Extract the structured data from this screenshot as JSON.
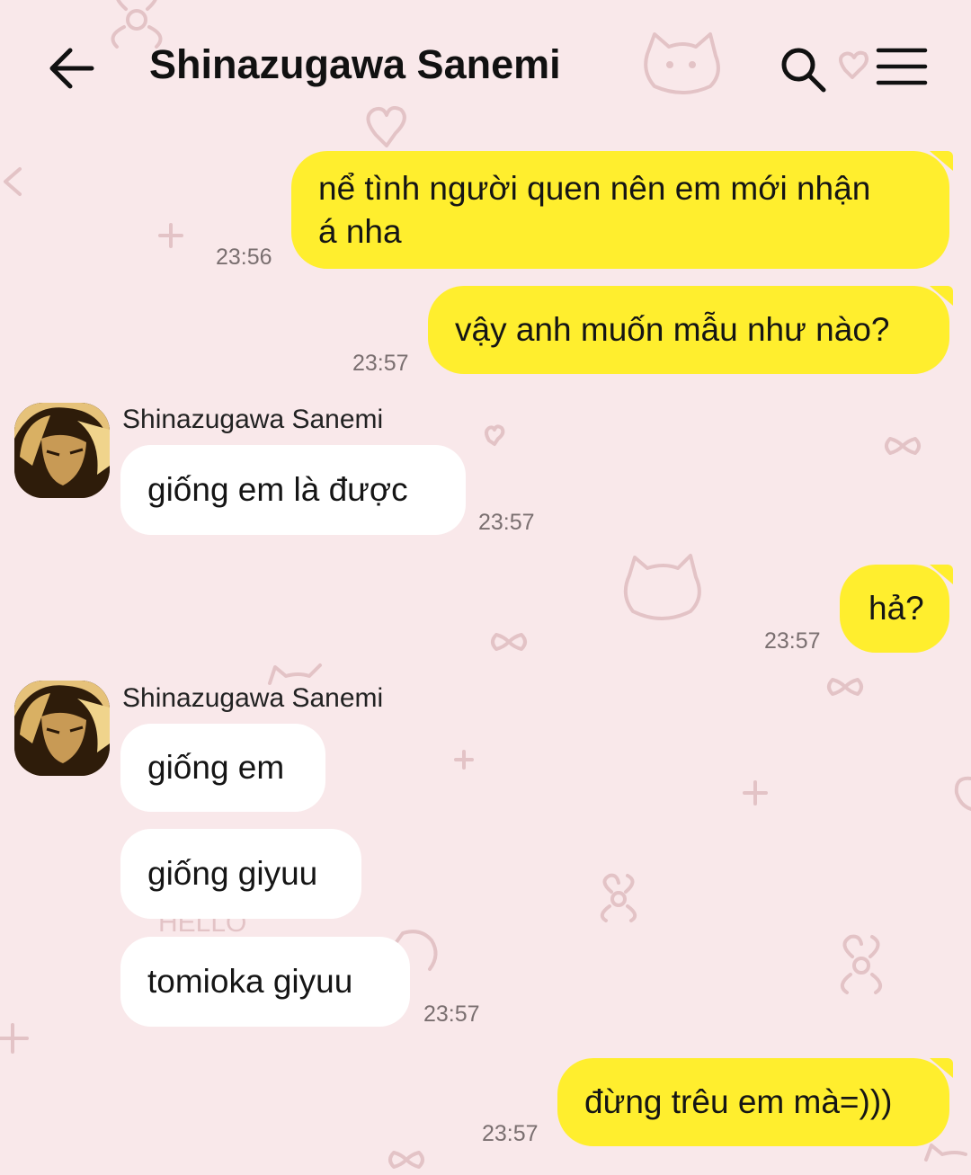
{
  "header": {
    "title": "Shinazugawa Sanemi",
    "back_icon": "arrow-left-icon",
    "search_icon": "search-icon",
    "menu_icon": "hamburger-menu-icon"
  },
  "colors": {
    "background": "#f9e8ea",
    "outgoing_bubble": "#ffee2e",
    "incoming_bubble": "#ffffff",
    "doodle": "#e3c3c6"
  },
  "messages": [
    {
      "direction": "outgoing",
      "text_line1": "nể tình người quen nên em mới nhận",
      "text_line2": "á nha",
      "time": "23:56"
    },
    {
      "direction": "outgoing",
      "text": "vậy anh muốn mẫu như nào?",
      "time": "23:57"
    },
    {
      "direction": "incoming",
      "sender": "Shinazugawa Sanemi",
      "text": "giống em là được",
      "time": "23:57"
    },
    {
      "direction": "outgoing",
      "text": "hả?",
      "time": "23:57"
    },
    {
      "direction": "incoming",
      "sender": "Shinazugawa Sanemi",
      "texts": [
        "giống em",
        "giống giyuu",
        "tomioka giyuu"
      ],
      "time": "23:57"
    },
    {
      "direction": "outgoing",
      "text": "đừng trêu em mà=)))",
      "time": "23:57"
    }
  ],
  "wallpaper": {
    "doodle_text": "HELLO"
  }
}
